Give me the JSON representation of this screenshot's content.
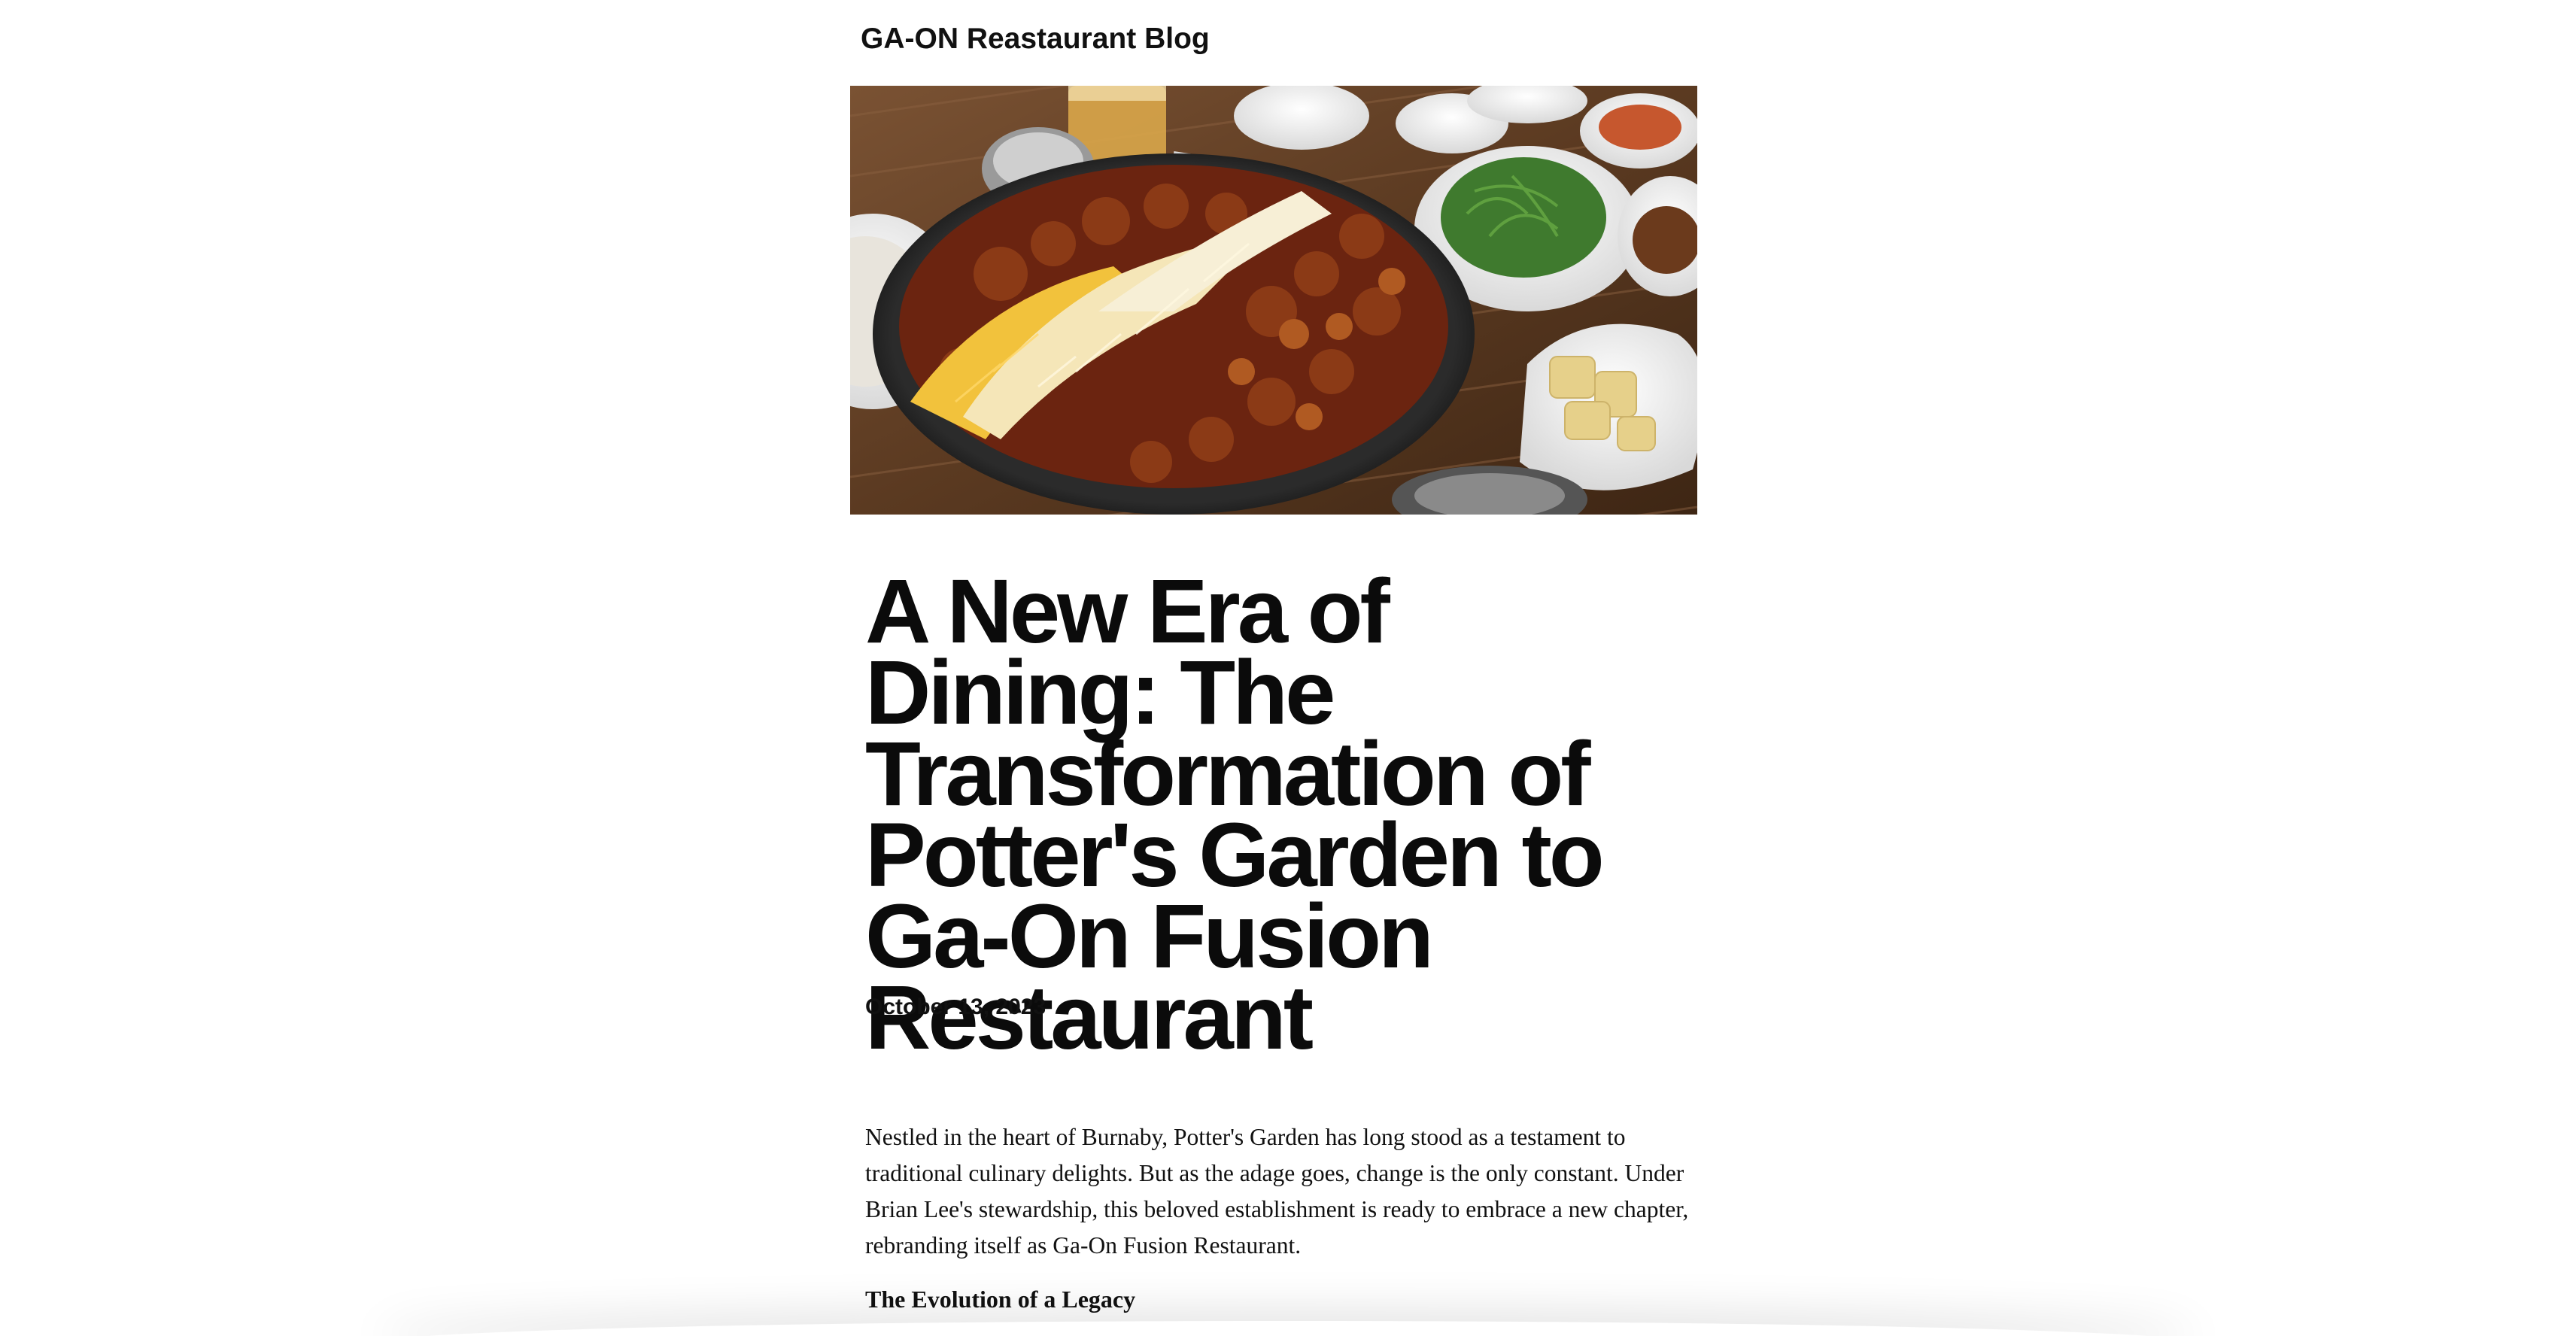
{
  "blog": {
    "title": "GA-ON Reastaurant Blog"
  },
  "hero_image": {
    "alt": "Korean dakgalbi with melted cheese on a cast iron pan surrounded by side dishes"
  },
  "post": {
    "title": "A New Era of Dining: The Transformation of Potter's Garden to Ga-On Fusion Restaurant",
    "date": "October 13, 2023",
    "intro": "Nestled in the heart of Burnaby, Potter's Garden has long stood as a testament to traditional culinary delights. But as the adage goes, change is the only constant. Under Brian Lee's stewardship, this beloved establishment is ready to embrace a new chapter, rebranding itself as Ga-On Fusion Restaurant.",
    "section_heading": "The Evolution of a Legacy"
  }
}
